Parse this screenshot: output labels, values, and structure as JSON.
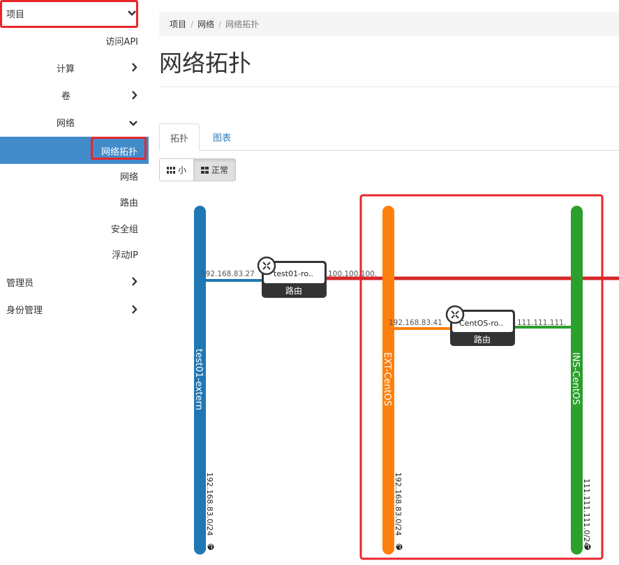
{
  "sidebar": {
    "project": "项目",
    "access_api": "访问API",
    "compute": "计算",
    "volumes": "卷",
    "network": "网络",
    "network_topology": "网络拓扑",
    "networks": "网络",
    "routers": "路由",
    "security_groups": "安全组",
    "floating_ip": "浮动IP",
    "admin": "管理员",
    "identity": "身份管理"
  },
  "breadcrumb": [
    "项目",
    "网络",
    "网络拓扑"
  ],
  "page_title": "网络拓扑",
  "tabs": [
    "拓扑",
    "图表"
  ],
  "view_buttons": {
    "small": "小",
    "normal": "正常"
  },
  "colors": {
    "active_bg": "#428bca",
    "highlight": "#e8262a",
    "net_extern": "#1f77b4",
    "net_ext_centos": "#ff7f0e",
    "net_ins_centos": "#2ca02c",
    "external_link": "#d62728"
  },
  "topology": {
    "networks": [
      {
        "name": "test01-extern",
        "cidr": "192.168.83.0/24",
        "color": "#1f77b4"
      },
      {
        "name": "EXT-CentOS",
        "cidr": "192.168.83.0/24",
        "color": "#ff7f0e"
      },
      {
        "name": "INS-CentOS",
        "cidr": "111.111.111.0/24",
        "color": "#2ca02c"
      }
    ],
    "routers": [
      {
        "name": "test01-ro..",
        "type_label": "路由",
        "ip_left": "192.168.83.27",
        "ip_right": "100.100.100."
      },
      {
        "name": "CentOS-ro..",
        "type_label": "路由",
        "ip_left": "192.168.83.41",
        "ip_right": "111.111.111."
      }
    ]
  }
}
